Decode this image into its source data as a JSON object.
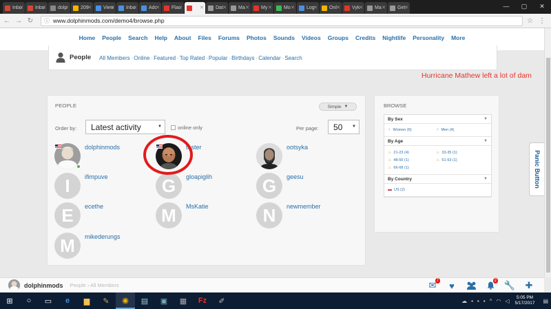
{
  "browser": {
    "tabs": [
      {
        "label": "Inbo",
        "color": "#d44638"
      },
      {
        "label": "Inbo",
        "color": "#d44638"
      },
      {
        "label": "dolp",
        "color": "#888888"
      },
      {
        "label": "209",
        "color": "#f4b400"
      },
      {
        "label": "View",
        "color": "#4a90e2"
      },
      {
        "label": "Inbo",
        "color": "#4a90e2"
      },
      {
        "label": "Adc",
        "color": "#4a90e2"
      },
      {
        "label": "Flac",
        "color": "#e5332a"
      },
      {
        "label": "",
        "color": "#e5332a"
      },
      {
        "label": "Dat",
        "color": "#999999"
      },
      {
        "label": "Ma",
        "color": "#999999"
      },
      {
        "label": "My",
        "color": "#e5332a"
      },
      {
        "label": "Mo",
        "color": "#3cba54"
      },
      {
        "label": "Log",
        "color": "#4a90e2"
      },
      {
        "label": "Onl",
        "color": "#f4b400"
      },
      {
        "label": "Vyk",
        "color": "#e5332a"
      },
      {
        "label": "Ma",
        "color": "#999999"
      },
      {
        "label": "Get",
        "color": "#999999"
      }
    ],
    "active_tab_index": 8,
    "address": "www.dolphinmods.com/demo4/browse.php"
  },
  "nav": [
    "Home",
    "People",
    "Search",
    "Help",
    "About",
    "Files",
    "Forums",
    "Photos",
    "Sounds",
    "Videos",
    "Groups",
    "Credits",
    "Nightlife",
    "Personality",
    "More"
  ],
  "subheader": {
    "title": "People",
    "links": [
      "All Members",
      "Online",
      "Featured",
      "Top Rated",
      "Popular",
      "Birthdays",
      "Calendar",
      "Search"
    ],
    "separator": "·"
  },
  "marquee": "Hurricane Mathew left a lot of dam",
  "people_panel": {
    "title": "PEOPLE",
    "view_button": "Simple",
    "order_label": "Order by:",
    "order_value": "Latest activity",
    "online_only_label": "online only",
    "per_page_label": "Per page:",
    "per_page_value": "50",
    "members": [
      {
        "name": "dolphinmods",
        "initial": "",
        "photo": true,
        "flag": true,
        "online": true
      },
      {
        "name": "tester",
        "initial": "",
        "photo": true,
        "flag": true,
        "online": false
      },
      {
        "name": "ootsyka",
        "initial": "",
        "photo": true,
        "flag": false,
        "online": false
      },
      {
        "name": "ifimpuve",
        "initial": "I",
        "photo": false
      },
      {
        "name": "gloapiglih",
        "initial": "G",
        "photo": false
      },
      {
        "name": "geesu",
        "initial": "G",
        "photo": false
      },
      {
        "name": "ecethe",
        "initial": "E",
        "photo": false
      },
      {
        "name": "MsKatie",
        "initial": "M",
        "photo": false
      },
      {
        "name": "newmember",
        "initial": "N",
        "photo": false
      },
      {
        "name": "mikederungs",
        "initial": "M",
        "photo": false
      }
    ]
  },
  "browse_panel": {
    "title": "BROWSE",
    "sections": [
      {
        "title": "By Sex",
        "items": [
          "Women (6)",
          "Men (4)"
        ]
      },
      {
        "title": "By Age",
        "items": [
          "21-23 (4)",
          "33-35 (1)",
          "48-50 (1)",
          "51-53 (1)",
          "66-68 (1)"
        ]
      },
      {
        "title": "By Country",
        "items": [
          "US (2)"
        ]
      }
    ]
  },
  "panic_button": "Panic Button",
  "account_bar": {
    "username": "dolphinmods",
    "breadcrumb": [
      "People",
      "All Members"
    ],
    "mail_badge": "7",
    "notif_badge": "2"
  },
  "taskbar": {
    "time": "5:05 PM",
    "date": "5/17/2017"
  },
  "colors": {
    "link": "#2a6fa8",
    "accent_red": "#e21b1b",
    "marquee_red": "#e5332a"
  }
}
